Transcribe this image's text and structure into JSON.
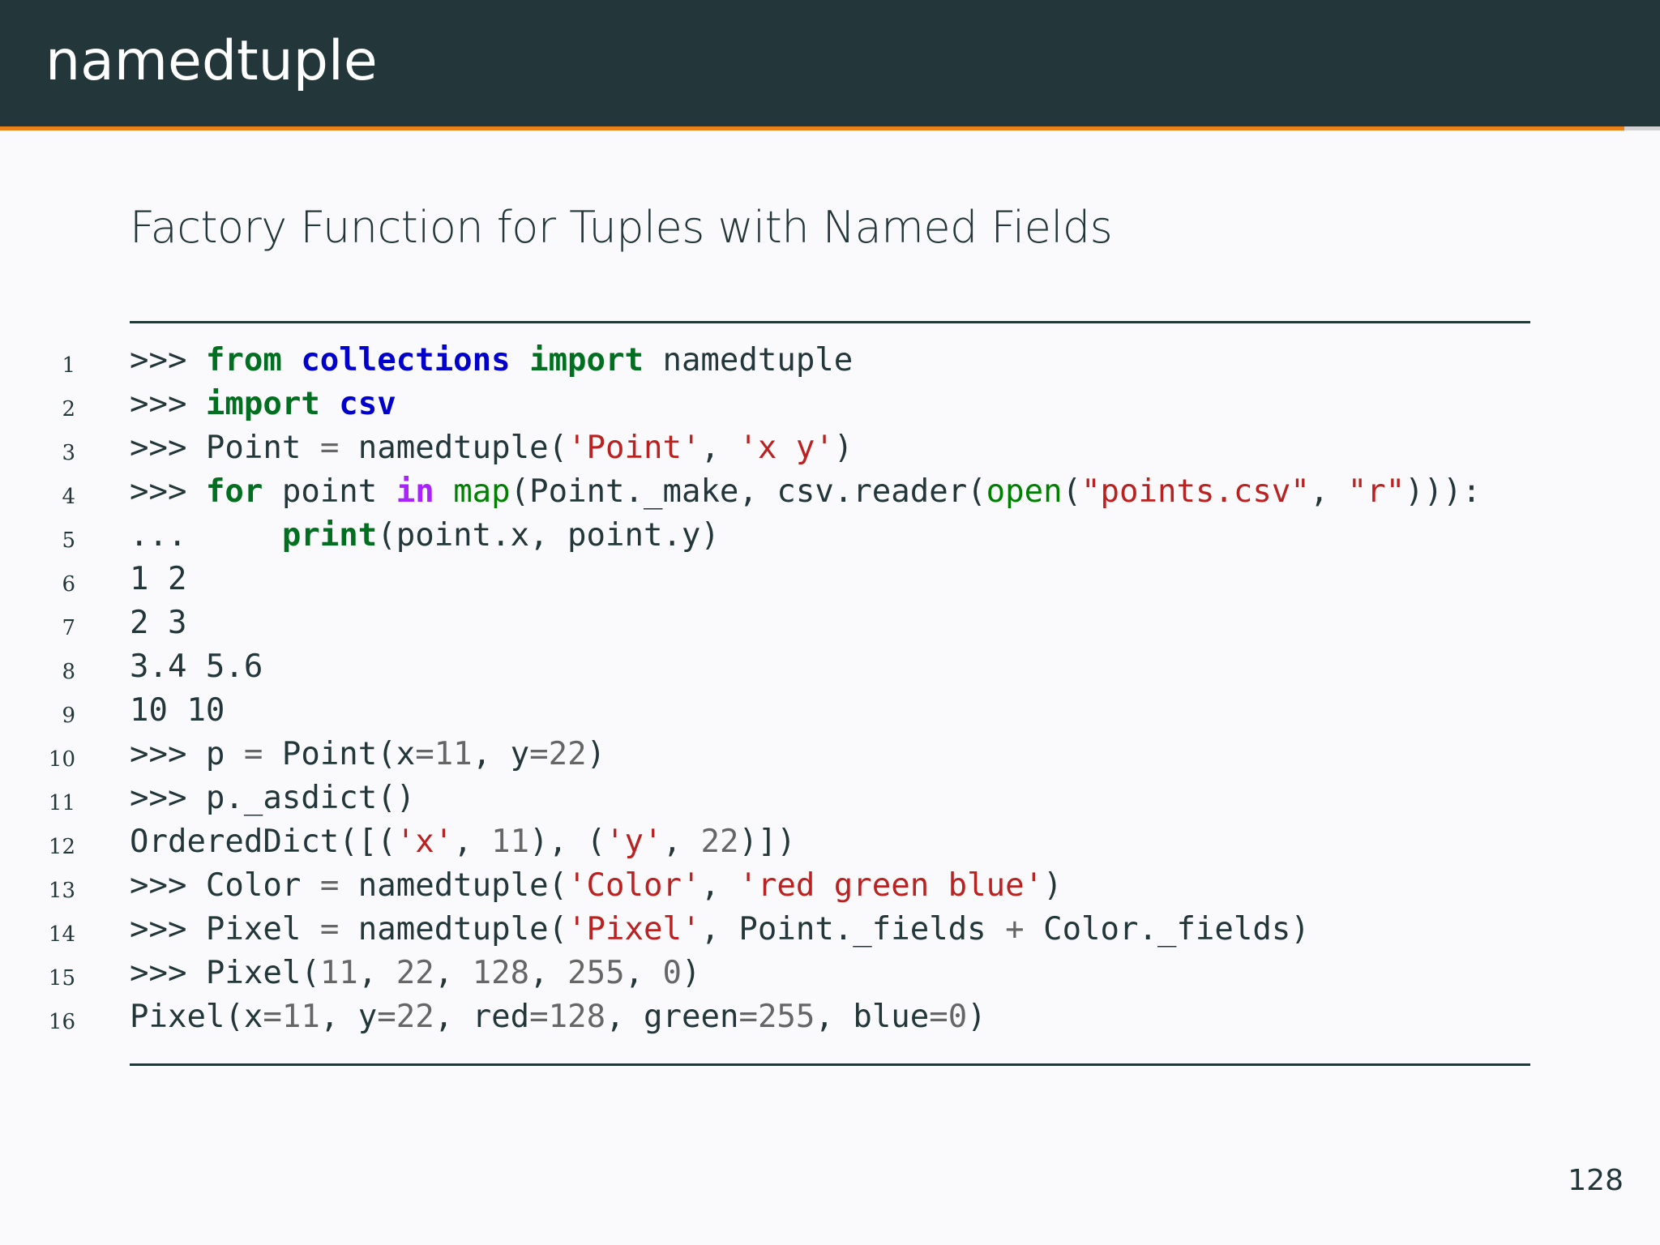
{
  "slide": {
    "title": "namedtuple",
    "subtitle": "Factory Function for Tuples with Named Fields",
    "page_number": "128"
  },
  "colors": {
    "header": "#23373b",
    "accent": "#eb811b",
    "text": "#23373b",
    "keyword": "#007020",
    "builtin": "#008000",
    "module": "#0000cc",
    "string": "#ba2121",
    "number": "#666666",
    "operator": "#666666",
    "in_keyword": "#aa22ff"
  },
  "code": {
    "lines": [
      {
        "number": "1",
        "tokens": [
          {
            "text": ">>> ",
            "type": "prompt"
          },
          {
            "text": "from",
            "type": "keyword"
          },
          {
            "text": " ",
            "type": "plain"
          },
          {
            "text": "collections",
            "type": "module"
          },
          {
            "text": " ",
            "type": "plain"
          },
          {
            "text": "import",
            "type": "keyword"
          },
          {
            "text": " namedtuple",
            "type": "plain"
          }
        ]
      },
      {
        "number": "2",
        "tokens": [
          {
            "text": ">>> ",
            "type": "prompt"
          },
          {
            "text": "import",
            "type": "keyword"
          },
          {
            "text": " ",
            "type": "plain"
          },
          {
            "text": "csv",
            "type": "module"
          }
        ]
      },
      {
        "number": "3",
        "tokens": [
          {
            "text": ">>> ",
            "type": "prompt"
          },
          {
            "text": "Point ",
            "type": "plain"
          },
          {
            "text": "=",
            "type": "operator"
          },
          {
            "text": " namedtuple(",
            "type": "plain"
          },
          {
            "text": "'Point'",
            "type": "string"
          },
          {
            "text": ", ",
            "type": "plain"
          },
          {
            "text": "'x y'",
            "type": "string"
          },
          {
            "text": ")",
            "type": "plain"
          }
        ]
      },
      {
        "number": "4",
        "tokens": [
          {
            "text": ">>> ",
            "type": "prompt"
          },
          {
            "text": "for",
            "type": "keyword"
          },
          {
            "text": " point ",
            "type": "plain"
          },
          {
            "text": "in",
            "type": "in_keyword"
          },
          {
            "text": " ",
            "type": "plain"
          },
          {
            "text": "map",
            "type": "builtin"
          },
          {
            "text": "(Point._make, csv.reader(",
            "type": "plain"
          },
          {
            "text": "open",
            "type": "builtin"
          },
          {
            "text": "(",
            "type": "plain"
          },
          {
            "text": "\"points.csv\"",
            "type": "string"
          },
          {
            "text": ", ",
            "type": "plain"
          },
          {
            "text": "\"r\"",
            "type": "string"
          },
          {
            "text": "))):",
            "type": "plain"
          }
        ]
      },
      {
        "number": "5",
        "tokens": [
          {
            "text": "...     ",
            "type": "prompt"
          },
          {
            "text": "print",
            "type": "keyword"
          },
          {
            "text": "(point.x, point.y)",
            "type": "plain"
          }
        ]
      },
      {
        "number": "6",
        "tokens": [
          {
            "text": "1 2",
            "type": "output"
          }
        ]
      },
      {
        "number": "7",
        "tokens": [
          {
            "text": "2 3",
            "type": "output"
          }
        ]
      },
      {
        "number": "8",
        "tokens": [
          {
            "text": "3.4 5.6",
            "type": "output"
          }
        ]
      },
      {
        "number": "9",
        "tokens": [
          {
            "text": "10 10",
            "type": "output"
          }
        ]
      },
      {
        "number": "10",
        "tokens": [
          {
            "text": ">>> ",
            "type": "prompt"
          },
          {
            "text": "p ",
            "type": "plain"
          },
          {
            "text": "=",
            "type": "operator"
          },
          {
            "text": " Point(x",
            "type": "plain"
          },
          {
            "text": "=",
            "type": "operator"
          },
          {
            "text": "11",
            "type": "number"
          },
          {
            "text": ", y",
            "type": "plain"
          },
          {
            "text": "=",
            "type": "operator"
          },
          {
            "text": "22",
            "type": "number"
          },
          {
            "text": ")",
            "type": "plain"
          }
        ]
      },
      {
        "number": "11",
        "tokens": [
          {
            "text": ">>> ",
            "type": "prompt"
          },
          {
            "text": "p._asdict()",
            "type": "plain"
          }
        ]
      },
      {
        "number": "12",
        "tokens": [
          {
            "text": "OrderedDict([(",
            "type": "plain"
          },
          {
            "text": "'x'",
            "type": "string"
          },
          {
            "text": ", ",
            "type": "plain"
          },
          {
            "text": "11",
            "type": "number"
          },
          {
            "text": "), (",
            "type": "plain"
          },
          {
            "text": "'y'",
            "type": "string"
          },
          {
            "text": ", ",
            "type": "plain"
          },
          {
            "text": "22",
            "type": "number"
          },
          {
            "text": ")])",
            "type": "plain"
          }
        ]
      },
      {
        "number": "13",
        "tokens": [
          {
            "text": ">>> ",
            "type": "prompt"
          },
          {
            "text": "Color ",
            "type": "plain"
          },
          {
            "text": "=",
            "type": "operator"
          },
          {
            "text": " namedtuple(",
            "type": "plain"
          },
          {
            "text": "'Color'",
            "type": "string"
          },
          {
            "text": ", ",
            "type": "plain"
          },
          {
            "text": "'red green blue'",
            "type": "string"
          },
          {
            "text": ")",
            "type": "plain"
          }
        ]
      },
      {
        "number": "14",
        "tokens": [
          {
            "text": ">>> ",
            "type": "prompt"
          },
          {
            "text": "Pixel ",
            "type": "plain"
          },
          {
            "text": "=",
            "type": "operator"
          },
          {
            "text": " namedtuple(",
            "type": "plain"
          },
          {
            "text": "'Pixel'",
            "type": "string"
          },
          {
            "text": ", Point._fields ",
            "type": "plain"
          },
          {
            "text": "+",
            "type": "operator"
          },
          {
            "text": " Color._fields)",
            "type": "plain"
          }
        ]
      },
      {
        "number": "15",
        "tokens": [
          {
            "text": ">>> ",
            "type": "prompt"
          },
          {
            "text": "Pixel(",
            "type": "plain"
          },
          {
            "text": "11",
            "type": "number"
          },
          {
            "text": ", ",
            "type": "plain"
          },
          {
            "text": "22",
            "type": "number"
          },
          {
            "text": ", ",
            "type": "plain"
          },
          {
            "text": "128",
            "type": "number"
          },
          {
            "text": ", ",
            "type": "plain"
          },
          {
            "text": "255",
            "type": "number"
          },
          {
            "text": ", ",
            "type": "plain"
          },
          {
            "text": "0",
            "type": "number"
          },
          {
            "text": ")",
            "type": "plain"
          }
        ]
      },
      {
        "number": "16",
        "tokens": [
          {
            "text": "Pixel(x",
            "type": "plain"
          },
          {
            "text": "=",
            "type": "operator"
          },
          {
            "text": "11",
            "type": "number"
          },
          {
            "text": ", y",
            "type": "plain"
          },
          {
            "text": "=",
            "type": "operator"
          },
          {
            "text": "22",
            "type": "number"
          },
          {
            "text": ", red",
            "type": "plain"
          },
          {
            "text": "=",
            "type": "operator"
          },
          {
            "text": "128",
            "type": "number"
          },
          {
            "text": ", green",
            "type": "plain"
          },
          {
            "text": "=",
            "type": "operator"
          },
          {
            "text": "255",
            "type": "number"
          },
          {
            "text": ", blue",
            "type": "plain"
          },
          {
            "text": "=",
            "type": "operator"
          },
          {
            "text": "0",
            "type": "number"
          },
          {
            "text": ")",
            "type": "plain"
          }
        ]
      }
    ]
  }
}
